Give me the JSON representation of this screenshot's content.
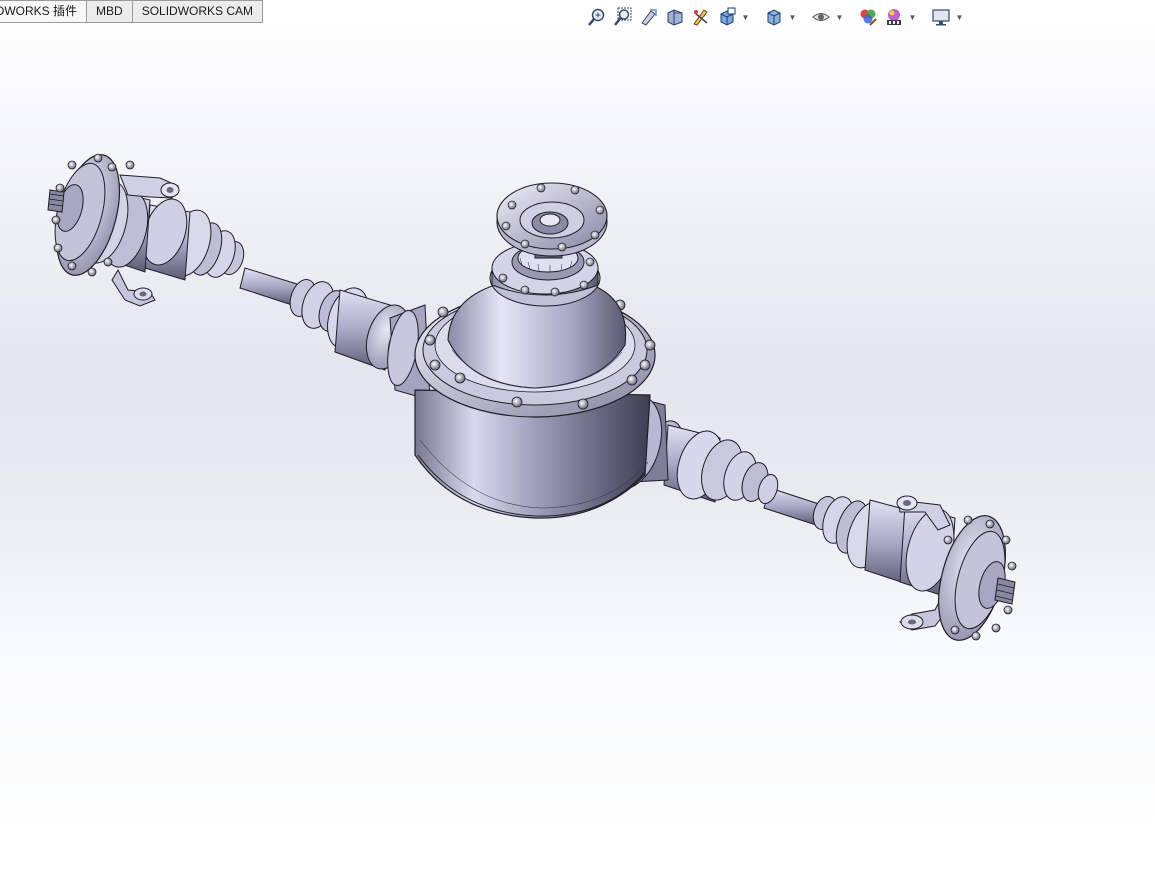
{
  "tabs": [
    {
      "label": "OWORKS 插件"
    },
    {
      "label": "MBD"
    },
    {
      "label": "SOLIDWORKS CAM"
    }
  ],
  "heads_up_toolbar": [
    {
      "icon": "zoom-to-fit-icon"
    },
    {
      "icon": "zoom-to-area-icon"
    },
    {
      "icon": "previous-view-icon"
    },
    {
      "icon": "section-view-icon"
    },
    {
      "icon": "dynamic-annotation-views-icon"
    },
    {
      "icon": "view-orientation-icon"
    },
    {
      "icon": "display-style-icon"
    },
    {
      "icon": "hide-show-items-icon"
    },
    {
      "icon": "edit-appearance-icon"
    },
    {
      "icon": "apply-scene-icon"
    },
    {
      "icon": "view-settings-icon"
    }
  ],
  "model": {
    "description_name": "drive-axle-assembly"
  },
  "colors": {
    "metal_light": "#d7d6ea",
    "metal_mid": "#a9a7c4",
    "metal_dark": "#5d5b73",
    "edge": "#1e1e28"
  }
}
